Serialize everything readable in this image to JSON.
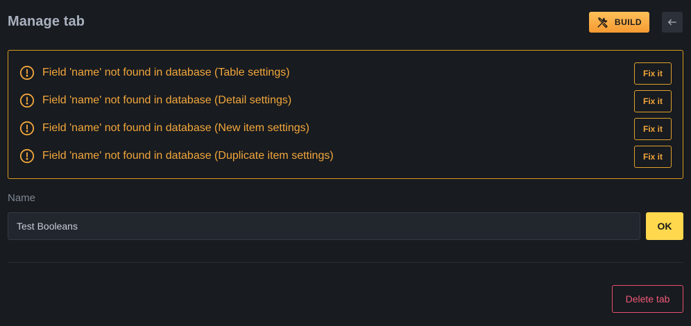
{
  "header": {
    "title": "Manage tab",
    "build_label": "BUILD"
  },
  "warnings": [
    {
      "message": "Field 'name' not found in database (Table settings)",
      "fix_label": "Fix it"
    },
    {
      "message": "Field 'name' not found in database (Detail settings)",
      "fix_label": "Fix it"
    },
    {
      "message": "Field 'name' not found in database (New item settings)",
      "fix_label": "Fix it"
    },
    {
      "message": "Field 'name' not found in database (Duplicate item settings)",
      "fix_label": "Fix it"
    }
  ],
  "form": {
    "name_label": "Name",
    "name_value": "Test Booleans",
    "ok_label": "OK"
  },
  "footer": {
    "delete_label": "Delete tab"
  },
  "icons": {
    "build": "tools-icon",
    "back": "arrow-left-icon",
    "warning": "exclamation-circle-icon"
  },
  "colors": {
    "background": "#181b20",
    "warning": "#f2a73b",
    "build_accent": "#f59a32",
    "ok_accent": "#ffd84d",
    "danger": "#e8506e"
  }
}
